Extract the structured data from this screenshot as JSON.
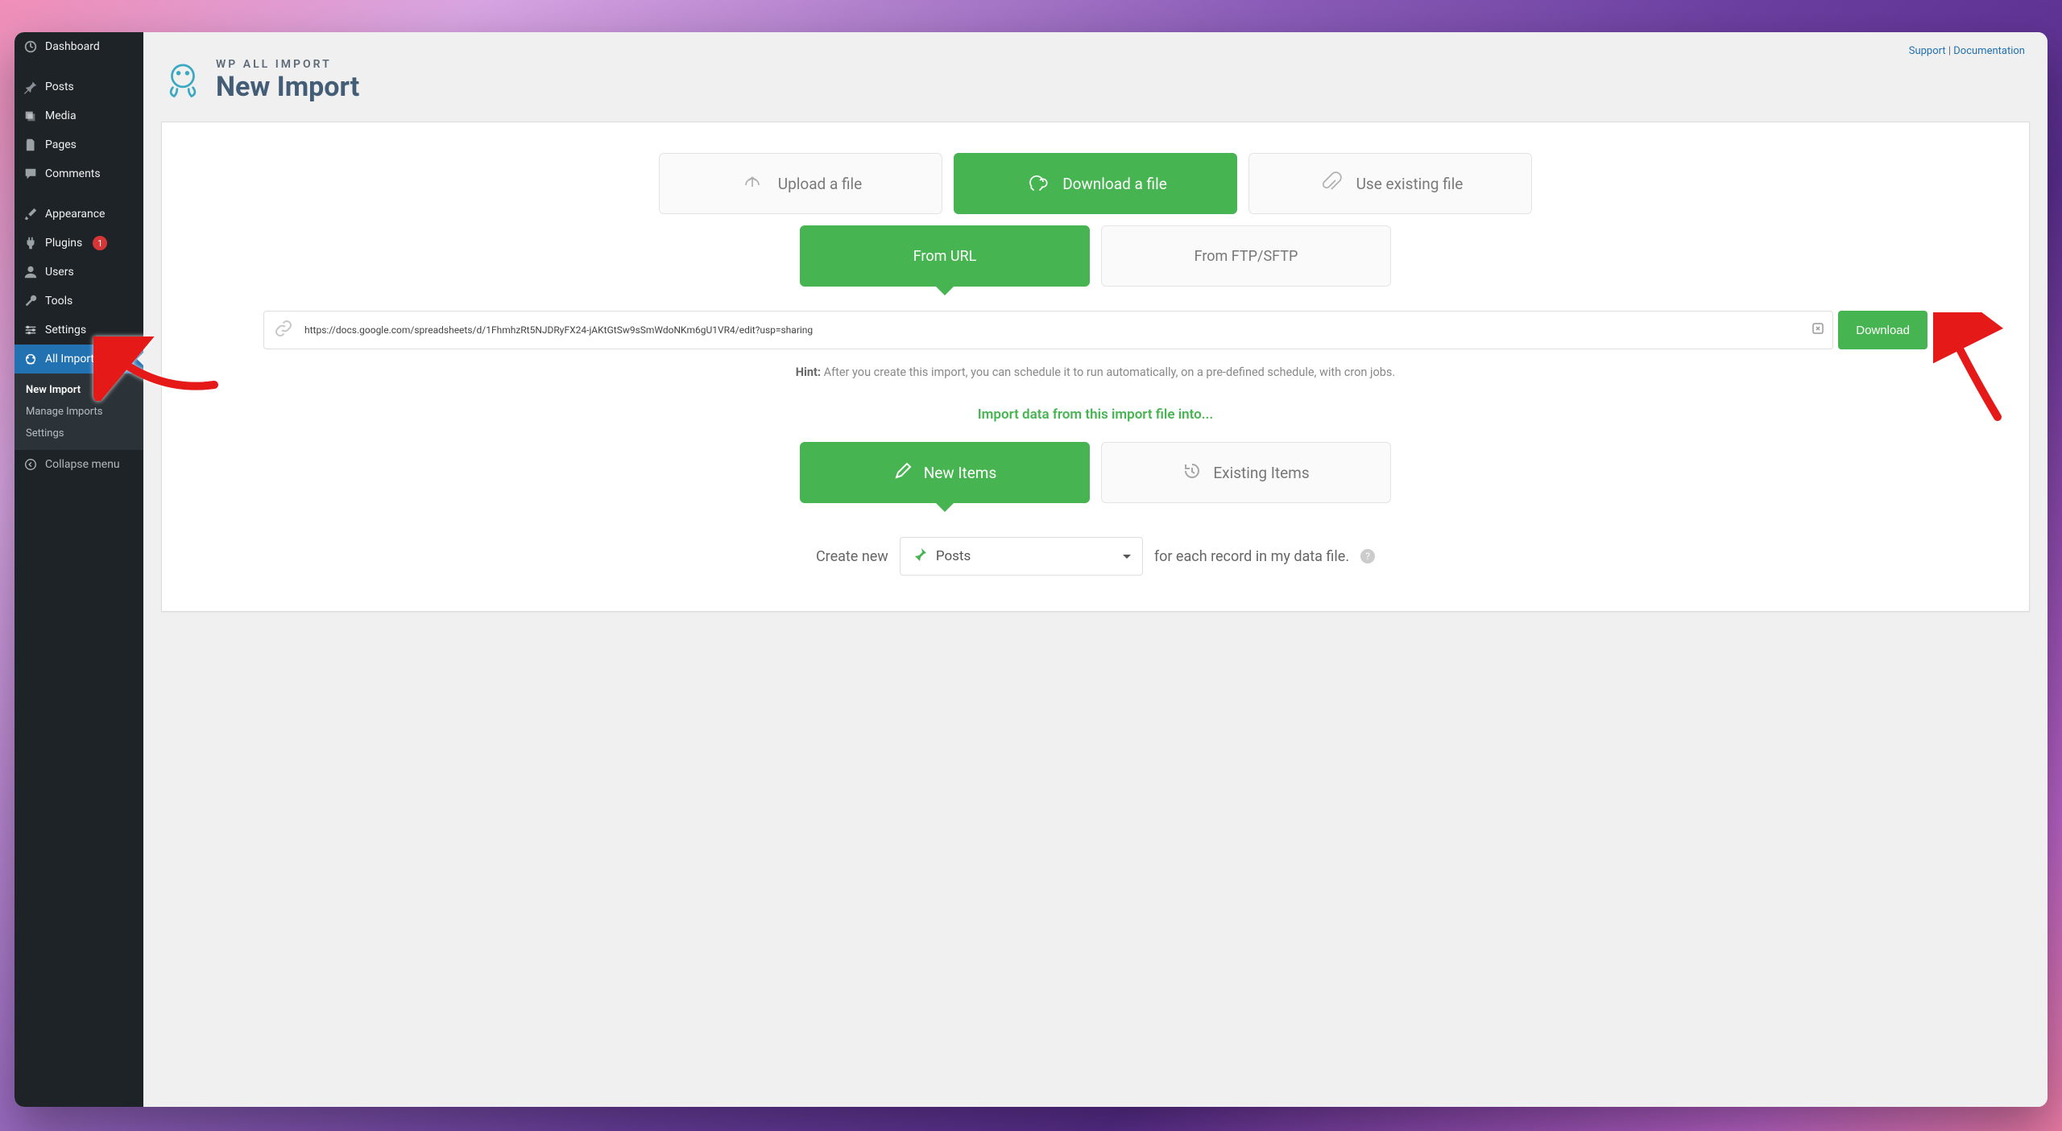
{
  "sidebar": {
    "items": [
      {
        "label": "Dashboard"
      },
      {
        "label": "Posts"
      },
      {
        "label": "Media"
      },
      {
        "label": "Pages"
      },
      {
        "label": "Comments"
      },
      {
        "label": "Appearance"
      },
      {
        "label": "Plugins",
        "badge": "1"
      },
      {
        "label": "Users"
      },
      {
        "label": "Tools"
      },
      {
        "label": "Settings"
      },
      {
        "label": "All Import"
      }
    ],
    "sub": [
      {
        "label": "New Import"
      },
      {
        "label": "Manage Imports"
      },
      {
        "label": "Settings"
      }
    ],
    "collapse": "Collapse menu"
  },
  "top_links": {
    "support": "Support",
    "separator": "|",
    "documentation": "Documentation"
  },
  "header": {
    "brand": "WP ALL IMPORT",
    "title": "New Import"
  },
  "source": {
    "upload": "Upload a file",
    "download": "Download a file",
    "existing": "Use existing file"
  },
  "download_tabs": {
    "from_url": "From URL",
    "from_ftp": "From FTP/SFTP"
  },
  "url_form": {
    "value": "https://docs.google.com/spreadsheets/d/1FhmhzRt5NJDRyFX24-jAKtGtSw9sSmWdoNKm6gU1VR4/edit?usp=sharing",
    "button": "Download"
  },
  "hint": {
    "prefix": "Hint:",
    "text": "After you create this import, you can schedule it to run automatically, on a pre-defined schedule, with cron jobs."
  },
  "into_label": "Import data from this import file into...",
  "items_tabs": {
    "new": "New Items",
    "existing": "Existing Items"
  },
  "create_row": {
    "prefix": "Create new",
    "select_value": "Posts",
    "suffix": "for each record in my data file.",
    "help": "?"
  }
}
